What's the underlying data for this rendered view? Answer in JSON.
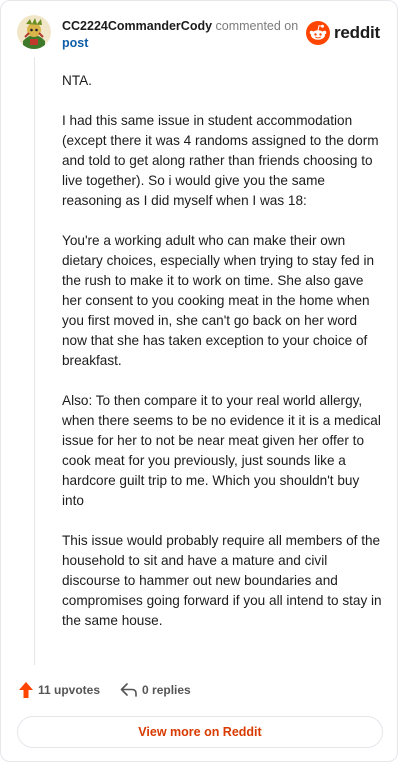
{
  "header": {
    "username": "CC2224CommanderCody",
    "action": "commented on",
    "post_link": "post",
    "brand": "reddit"
  },
  "comment": {
    "paragraphs": [
      "NTA.",
      "I had this same issue in student accommodation (except there it was 4 randoms assigned to the dorm and told to get along rather than friends choosing to live together). So i would give you the same reasoning as I did myself when I was 18:",
      "You're a working adult who can make their own dietary choices, especially when trying to stay fed in the rush to make it to work on time. She also gave her consent to you cooking meat in the home when you first moved in, she can't go back on her word now that she has taken exception to your choice of breakfast.",
      "Also: To then compare it to your real world allergy, when there seems to be no evidence it it is a medical issue for her to not be near meat given her offer to cook meat for you previously, just sounds like a hardcore guilt trip to me. Which you shouldn't buy into",
      "This issue would probably require all members of the household to sit and have a mature and civil discourse to hammer out new boundaries and compromises going forward if you all intend to stay in the same house."
    ]
  },
  "footer": {
    "upvotes": "11 upvotes",
    "replies": "0 replies",
    "view_button": "View more on Reddit"
  },
  "colors": {
    "brand_orange": "#ff4500",
    "link_blue": "#0f5ea8",
    "button_text": "#d93a00"
  },
  "icons": {
    "avatar": "snoo-avatar",
    "logo": "reddit-alien-icon",
    "upvote": "upvote-arrow-icon",
    "reply": "reply-arrow-icon"
  }
}
